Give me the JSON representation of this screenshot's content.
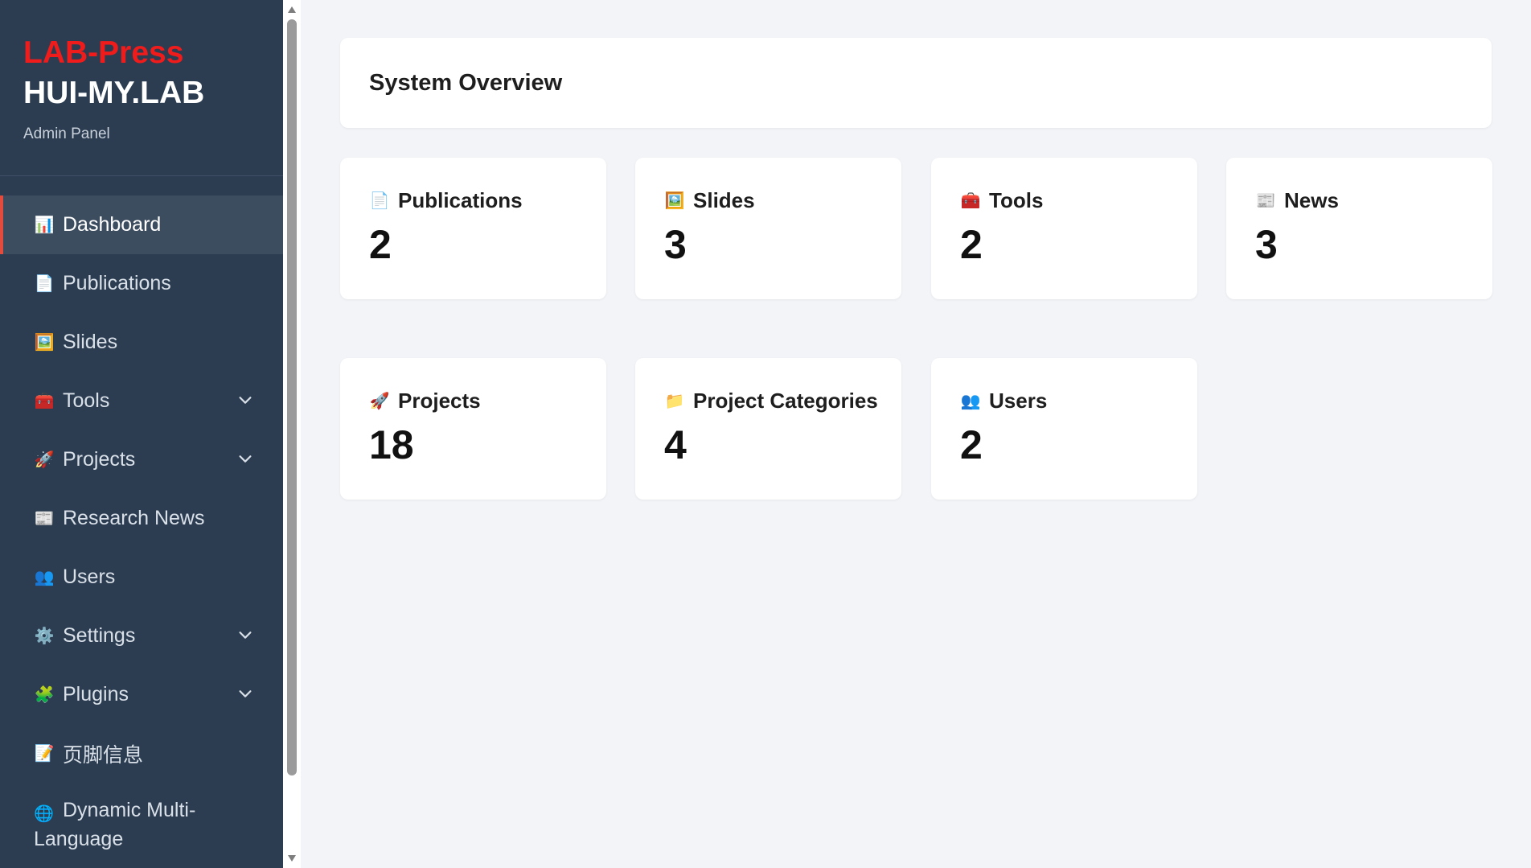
{
  "brand": {
    "name": "LAB-Press",
    "lab": "HUI-MY.LAB",
    "subtitle": "Admin Panel"
  },
  "sidebar": {
    "items": [
      {
        "label": "Dashboard",
        "icon": "bar-chart-icon",
        "glyph": "📊",
        "active": true,
        "expandable": false
      },
      {
        "label": "Publications",
        "icon": "document-icon",
        "glyph": "📄",
        "active": false,
        "expandable": false
      },
      {
        "label": "Slides",
        "icon": "picture-icon",
        "glyph": "🖼️",
        "active": false,
        "expandable": false
      },
      {
        "label": "Tools",
        "icon": "toolbox-icon",
        "glyph": "🧰",
        "active": false,
        "expandable": true
      },
      {
        "label": "Projects",
        "icon": "rocket-icon",
        "glyph": "🚀",
        "active": false,
        "expandable": true
      },
      {
        "label": "Research News",
        "icon": "newspaper-icon",
        "glyph": "📰",
        "active": false,
        "expandable": false
      },
      {
        "label": "Users",
        "icon": "users-icon",
        "glyph": "👥",
        "active": false,
        "expandable": false
      },
      {
        "label": "Settings",
        "icon": "gear-icon",
        "glyph": "⚙️",
        "active": false,
        "expandable": true
      },
      {
        "label": "Plugins",
        "icon": "puzzle-icon",
        "glyph": "🧩",
        "active": false,
        "expandable": true
      },
      {
        "label": "页脚信息",
        "icon": "memo-icon",
        "glyph": "📝",
        "active": false,
        "expandable": false
      },
      {
        "label": "Dynamic Multi-Language",
        "icon": "globe-icon",
        "glyph": "🌐",
        "active": false,
        "expandable": false
      }
    ]
  },
  "main": {
    "title": "System Overview",
    "cards": [
      {
        "title": "Publications",
        "value": "2",
        "icon": "document-icon",
        "glyph": "📄"
      },
      {
        "title": "Slides",
        "value": "3",
        "icon": "picture-icon",
        "glyph": "🖼️"
      },
      {
        "title": "Tools",
        "value": "2",
        "icon": "toolbox-icon",
        "glyph": "🧰"
      },
      {
        "title": "News",
        "value": "3",
        "icon": "newspaper-icon",
        "glyph": "📰"
      },
      {
        "title": "Projects",
        "value": "18",
        "icon": "rocket-icon",
        "glyph": "🚀"
      },
      {
        "title": "Project Categories",
        "value": "4",
        "icon": "folder-icon",
        "glyph": "📁"
      },
      {
        "title": "Users",
        "value": "2",
        "icon": "users-icon",
        "glyph": "👥"
      }
    ]
  },
  "colors": {
    "sidebar_bg": "#2c3d52",
    "active_bg": "#3d4d60",
    "active_accent": "#e34b3c",
    "brand_red": "#f01c1c",
    "page_bg": "#f3f4f8"
  }
}
